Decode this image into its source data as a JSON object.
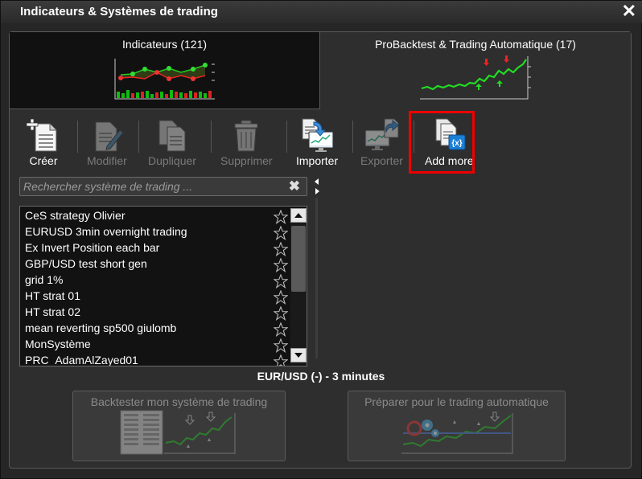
{
  "window": {
    "title": "Indicateurs & Systèmes de trading"
  },
  "tabs": [
    {
      "label": "Indicateurs (121)"
    },
    {
      "label": "ProBacktest & Trading Automatique (17)"
    }
  ],
  "toolbar": {
    "create": "Créer",
    "modify": "Modifier",
    "duplicate": "Dupliquer",
    "delete": "Supprimer",
    "import": "Importer",
    "export": "Exporter",
    "add_more": "Add more"
  },
  "search": {
    "placeholder": "Rechercher système de trading ..."
  },
  "systems": [
    "CeS strategy Olivier",
    "EURUSD 3min overnight trading",
    "Ex Invert Position each bar",
    "GBP/USD test short gen",
    "grid 1%",
    "HT strat 01",
    "HT strat 02",
    "mean reverting sp500 giulomb",
    "MonSystème",
    "PRC_AdamAlZayed01"
  ],
  "instrument": "EUR/USD (-) - 3 minutes",
  "actions": {
    "backtest": "Backtester mon système de trading",
    "auto": "Préparer pour le trading automatique"
  },
  "colors": {
    "highlight": "#e00000",
    "green": "#22cc22",
    "red": "#e02020"
  }
}
